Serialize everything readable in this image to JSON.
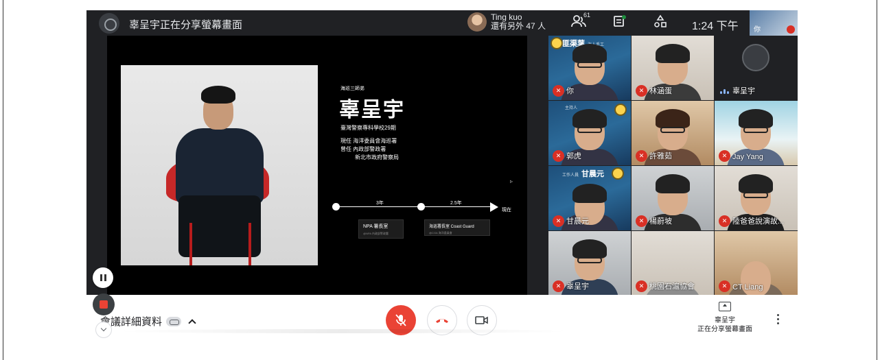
{
  "topbar": {
    "presenting_title": "辜呈宇正在分享螢幕畫面",
    "presenter_name": "Ting kuo",
    "presenter_others": "還有另外 47 人",
    "people_count": "61",
    "clock": "1:24 下午",
    "self_label": "你"
  },
  "slide": {
    "subtitle": "海巡三師弟",
    "name": "辜呈宇",
    "school": "臺灣警察專科學校29期",
    "current": "現任 海洋委員會海巡署",
    "past": "曾任 內政部警政署",
    "past2": "新北市政府警察局",
    "tl_label_1": "3年",
    "tl_label_2": "2.5年",
    "tl_label_now": "現在",
    "card_1": "NPA 署長室",
    "card_1_sub": "@NPA 內政部警政署",
    "card_2": "海巡署長室 Coast Guard",
    "card_2_sub": "@CGA 海洋委員會"
  },
  "participants": [
    {
      "name": "你",
      "banner": "匪渠葉",
      "banner_sub": "海人手工"
    },
    {
      "name": "林涵蛋"
    },
    {
      "name": "辜呈宇"
    },
    {
      "name": "郭虎",
      "banner_sub": "主持人"
    },
    {
      "name": "許雅茹"
    },
    {
      "name": "Jay Yang"
    },
    {
      "name": "甘晨元",
      "banner": "甘晨元",
      "banner_sub": "工作人員"
    },
    {
      "name": "楊蔚坡"
    },
    {
      "name": "陸爸爸說演故..."
    },
    {
      "name": "辜呈宇"
    },
    {
      "name": "桃園石滬協會"
    },
    {
      "name": "CT Liang"
    }
  ],
  "bottombar": {
    "details": "會議詳細資料",
    "present_name": "辜呈宇",
    "present_status": "正在分享螢幕畫面"
  },
  "colors": {
    "mic_off": "#ea4335",
    "meet_bg": "#202124",
    "speaking": "#8ab4f8"
  }
}
